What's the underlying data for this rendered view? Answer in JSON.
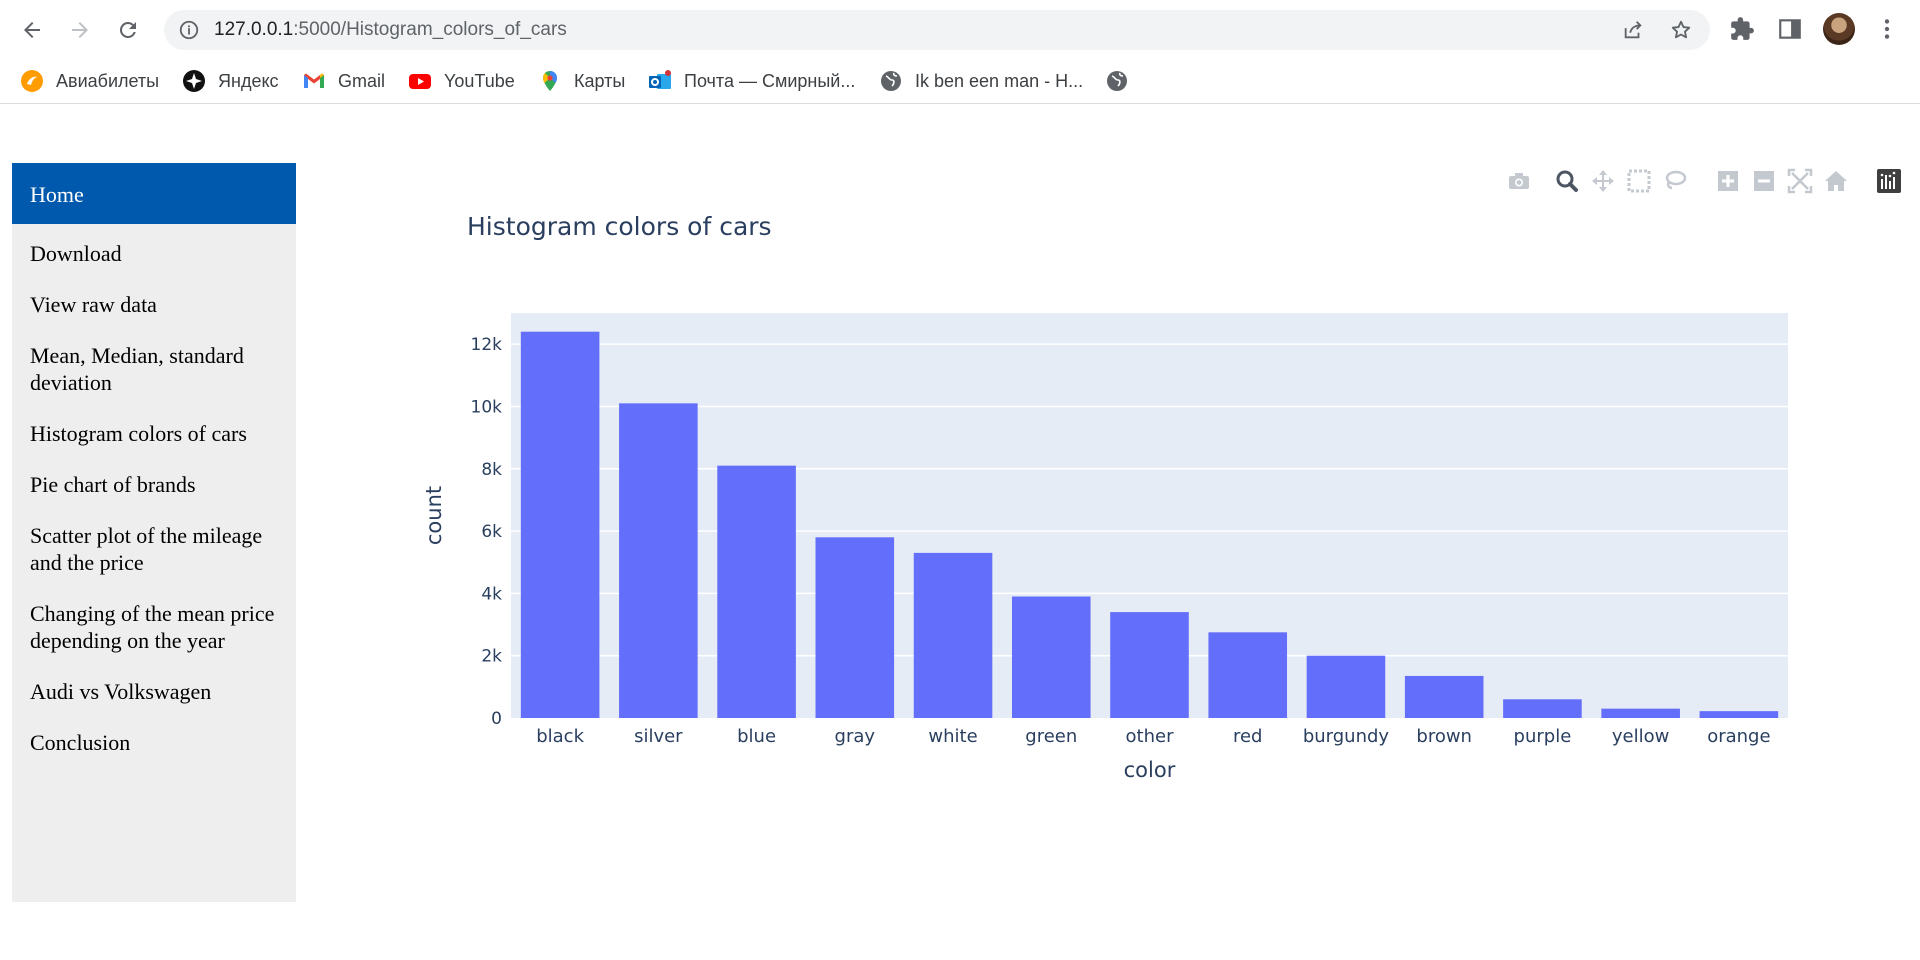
{
  "browser": {
    "url_host": "127.0.0.1",
    "url_rest": ":5000/Histogram_colors_of_cars",
    "bookmarks": [
      {
        "label": "Авиабилеты",
        "icon": "aviasales-icon"
      },
      {
        "label": "Яндекс",
        "icon": "yandex-icon"
      },
      {
        "label": "Gmail",
        "icon": "gmail-icon"
      },
      {
        "label": "YouTube",
        "icon": "youtube-icon"
      },
      {
        "label": "Карты",
        "icon": "google-maps-icon"
      },
      {
        "label": "Почта — Смирный...",
        "icon": "outlook-icon"
      },
      {
        "label": "Ik ben een man - H...",
        "icon": "globe-icon"
      },
      {
        "label": "",
        "icon": "globe-icon"
      }
    ]
  },
  "sidebar": {
    "items": [
      {
        "label": "Home",
        "active": true
      },
      {
        "label": "Download"
      },
      {
        "label": "View raw data"
      },
      {
        "label": "Mean, Median, standard deviation"
      },
      {
        "label": "Histogram colors of cars"
      },
      {
        "label": "Pie chart of brands"
      },
      {
        "label": "Scatter plot of the mileage and the price"
      },
      {
        "label": "Changing of the mean price depending on the year"
      },
      {
        "label": "Audi vs Volkswagen"
      },
      {
        "label": "Conclusion"
      }
    ]
  },
  "colors": {
    "accent": "#0059ac",
    "bar": "#636efa",
    "plot_bg": "#e5ecf6",
    "title": "#2a3f5f"
  },
  "modebar": [
    "camera-icon",
    "zoom-icon",
    "pan-icon",
    "box-select-icon",
    "lasso-select-icon",
    "zoom-in-icon",
    "zoom-out-icon",
    "autoscale-icon",
    "reset-axes-icon",
    "plotly-logo-icon"
  ],
  "chart_data": {
    "type": "bar",
    "title": "Histogram colors of cars",
    "xlabel": "color",
    "ylabel": "count",
    "categories": [
      "black",
      "silver",
      "blue",
      "gray",
      "white",
      "green",
      "other",
      "red",
      "burgundy",
      "brown",
      "purple",
      "yellow",
      "orange"
    ],
    "values": [
      12400,
      10100,
      8100,
      5800,
      5300,
      3900,
      3400,
      2750,
      2000,
      1350,
      600,
      300,
      220
    ],
    "ylim": [
      0,
      13000
    ],
    "yticks": [
      0,
      2000,
      4000,
      6000,
      8000,
      10000,
      12000
    ],
    "ytick_labels": [
      "0",
      "2k",
      "4k",
      "6k",
      "8k",
      "10k",
      "12k"
    ],
    "grid": true,
    "legend": "none"
  }
}
